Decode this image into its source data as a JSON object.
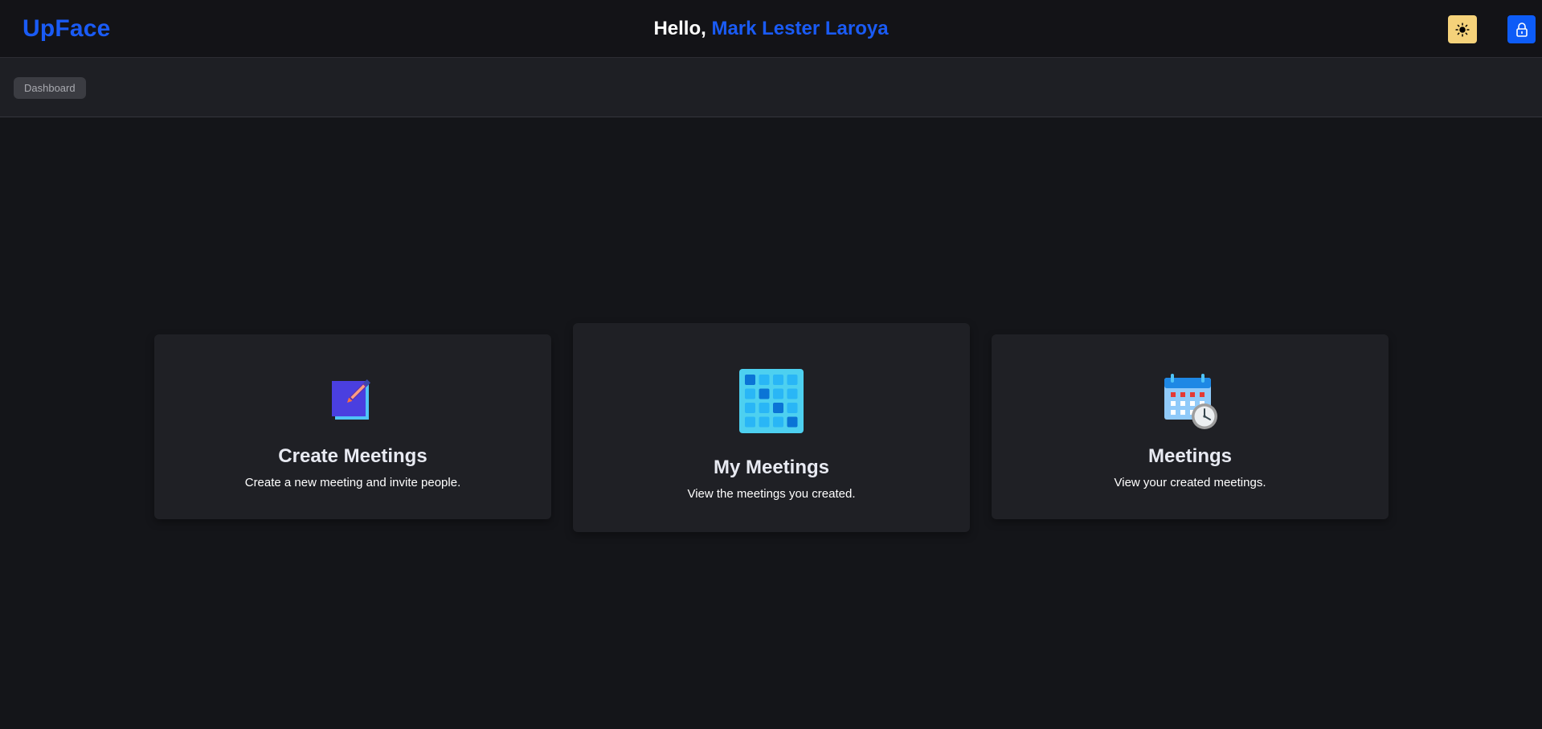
{
  "header": {
    "brand": "UpFace",
    "greeting_prefix": "Hello, ",
    "user_name": "Mark Lester Laroya",
    "theme_toggle_icon": "sun-icon",
    "lock_icon": "lock-icon"
  },
  "breadcrumb": {
    "items": [
      "Dashboard"
    ]
  },
  "cards": [
    {
      "title": "Create Meetings",
      "description": "Create a new meeting and invite people.",
      "icon": "edit-note-icon"
    },
    {
      "title": "My Meetings",
      "description": "View the meetings you created.",
      "icon": "grid-calendar-icon"
    },
    {
      "title": "Meetings",
      "description": "View your created meetings.",
      "icon": "calendar-clock-icon"
    }
  ],
  "colors": {
    "background": "#141519",
    "brand": "#1a5bf5",
    "theme_button": "#f5d27a",
    "lock_button": "#0d5cf7",
    "card": "#1f2025"
  }
}
